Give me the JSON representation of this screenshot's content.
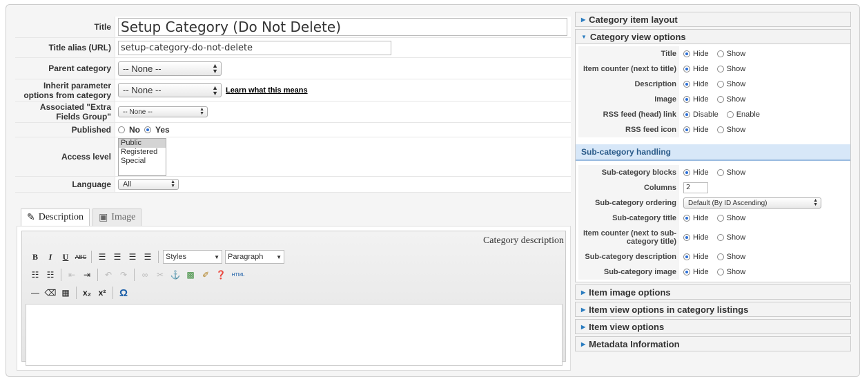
{
  "form": {
    "title": {
      "label": "Title",
      "value": "Setup Category (Do Not Delete)"
    },
    "alias": {
      "label": "Title alias (URL)",
      "value": "setup-category-do-not-delete"
    },
    "parent": {
      "label": "Parent category",
      "value": "-- None --"
    },
    "inherit": {
      "label": "Inherit parameter options from category",
      "value": "-- None --",
      "link": "Learn what this means"
    },
    "extra": {
      "label": "Associated \"Extra Fields Group\"",
      "value": "-- None --"
    },
    "published": {
      "label": "Published",
      "no": "No",
      "yes": "Yes"
    },
    "access": {
      "label": "Access level",
      "options": [
        "Public",
        "Registered",
        "Special"
      ]
    },
    "language": {
      "label": "Language",
      "value": "All"
    }
  },
  "tabs": [
    {
      "label": "Description"
    },
    {
      "label": "Image"
    }
  ],
  "editor": {
    "caption": "Category description",
    "bold": "B",
    "italic": "I",
    "underline": "U",
    "strike": "ABC",
    "styles": "Styles",
    "format": "Paragraph",
    "html": "HTML",
    "omega": "Ω"
  },
  "right": {
    "item_layout": "Category item layout",
    "view_options": "Category view options",
    "options": [
      {
        "label": "Title",
        "a": "Hide",
        "b": "Show"
      },
      {
        "label": "Item counter (next to title)",
        "a": "Hide",
        "b": "Show"
      },
      {
        "label": "Description",
        "a": "Hide",
        "b": "Show"
      },
      {
        "label": "Image",
        "a": "Hide",
        "b": "Show"
      },
      {
        "label": "RSS feed (head) link",
        "a": "Disable",
        "b": "Enable"
      },
      {
        "label": "RSS feed icon",
        "a": "Hide",
        "b": "Show"
      }
    ],
    "sub_heading": "Sub-category handling",
    "sub_blocks": {
      "label": "Sub-category blocks",
      "a": "Hide",
      "b": "Show"
    },
    "columns": {
      "label": "Columns",
      "value": "2"
    },
    "ordering": {
      "label": "Sub-category ordering",
      "value": "Default (By ID Ascending)"
    },
    "sub_options": [
      {
        "label": "Sub-category title",
        "a": "Hide",
        "b": "Show"
      },
      {
        "label": "Item counter (next to sub-category title)",
        "a": "Hide",
        "b": "Show"
      },
      {
        "label": "Sub-category description",
        "a": "Hide",
        "b": "Show"
      },
      {
        "label": "Sub-category image",
        "a": "Hide",
        "b": "Show"
      }
    ],
    "panels": [
      "Item image options",
      "Item view options in category listings",
      "Item view options",
      "Metadata Information"
    ]
  }
}
